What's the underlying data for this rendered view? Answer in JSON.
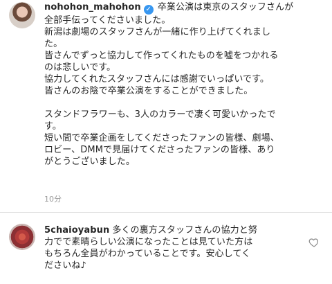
{
  "post": {
    "username": "nohohon_mahohon",
    "verified_icon": "verified-badge-icon",
    "verified_glyph": "✓",
    "lines": [
      "卒業公演は東京のスタッフさんが",
      "全部手伝ってくださいました。",
      "新潟は劇場のスタッフさんが一緒に作り上げてくれまし",
      "た。",
      "皆さんでずっと協力して作ってくれたものを嘘をつかれる",
      "のは悲しいです。",
      "協力してくれたスタッフさんには感謝でいっぱいです。",
      "皆さんのお陰で卒業公演をすることができました。",
      "",
      "スタンドフラワーも、3人のカラーで凄く可愛いかったで",
      "す。",
      "短い間で卒業企画をしてくださったファンの皆様、劇場、",
      "ロビー、DMMで見届けてくださったファンの皆様、あり",
      "がとうございました。"
    ],
    "timestamp": "10分"
  },
  "reply": {
    "username": "5chaioyabun",
    "lines": [
      "多くの裏方スタッフさんの協力と努",
      "力でで素晴らしい公演になったことは見ていた方は",
      "もちろん全員がわかっていることです。安心してく",
      "ださいね♪"
    ],
    "like_icon": "heart-outline-icon"
  },
  "colors": {
    "text": "#262626",
    "muted": "#999999",
    "verified": "#3897f0",
    "divider": "#dbdbdb"
  }
}
